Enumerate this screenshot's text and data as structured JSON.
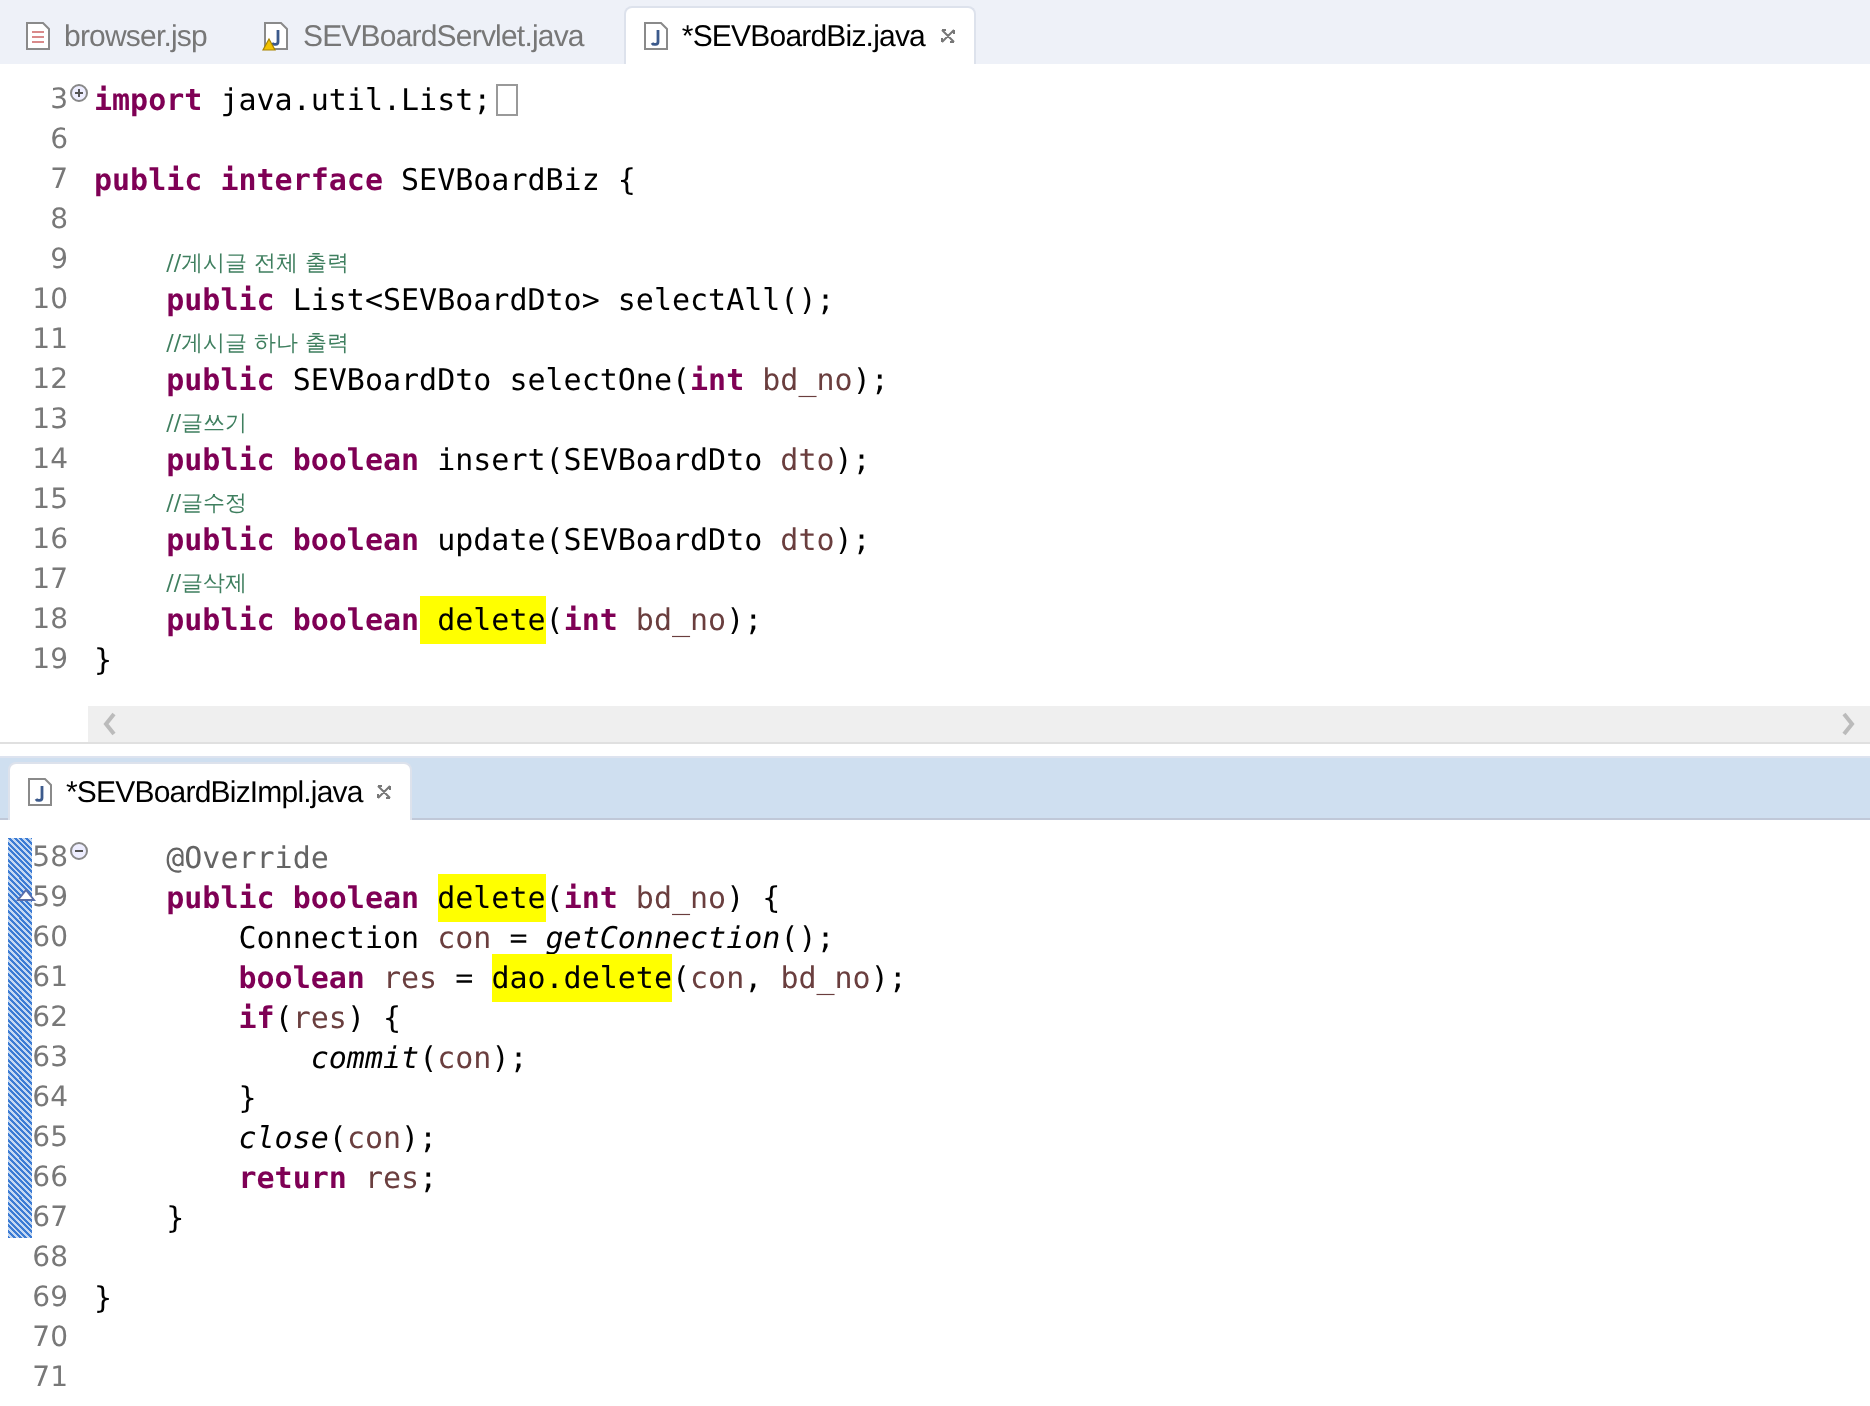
{
  "top_editor": {
    "tabs": [
      {
        "label": "browser.jsp",
        "kind": "jsp",
        "warning": false,
        "selected": false,
        "closable": false
      },
      {
        "label": "SEVBoardServlet.java",
        "kind": "java",
        "warning": true,
        "selected": false,
        "closable": false
      },
      {
        "label": "*SEVBoardBiz.java",
        "kind": "java",
        "warning": false,
        "selected": true,
        "closable": true
      }
    ],
    "lines": [
      {
        "number": "3",
        "folded": true,
        "changed": false,
        "override": false,
        "tokens": [
          {
            "kind": "kw",
            "t": "import",
            "highlighted": false
          },
          {
            "kind": "plain",
            "t": " java.util.List;",
            "highlighted": false
          }
        ]
      },
      {
        "number": "6",
        "changed": false,
        "override": false
      },
      {
        "number": "7",
        "changed": false,
        "override": false,
        "tokens": [
          {
            "kind": "kw",
            "t": "public interface",
            "highlighted": false
          },
          {
            "kind": "plain",
            "t": " SEVBoardBiz {",
            "highlighted": false
          }
        ]
      },
      {
        "number": "8",
        "changed": false,
        "override": false
      },
      {
        "number": "9",
        "changed": false,
        "override": false,
        "tokens": [
          {
            "kind": "comment",
            "t": "    //게시글 전체 출력",
            "highlighted": false
          }
        ]
      },
      {
        "number": "10",
        "changed": false,
        "override": false,
        "tokens": [
          {
            "kind": "kw",
            "t": "    public",
            "highlighted": false
          },
          {
            "kind": "plain",
            "t": " List<SEVBoardDto> selectAll();",
            "highlighted": false
          }
        ]
      },
      {
        "number": "11",
        "changed": false,
        "override": false,
        "tokens": [
          {
            "kind": "comment",
            "t": "    //게시글 하나 출력",
            "highlighted": false
          }
        ]
      },
      {
        "number": "12",
        "changed": false,
        "override": false,
        "tokens": [
          {
            "kind": "kw",
            "t": "    public",
            "highlighted": false
          },
          {
            "kind": "plain",
            "t": " SEVBoardDto selectOne(",
            "highlighted": false
          },
          {
            "kind": "kw",
            "t": "int",
            "highlighted": false
          },
          {
            "kind": "var",
            "t": " bd_no",
            "highlighted": false
          },
          {
            "kind": "plain",
            "t": ");",
            "highlighted": false
          }
        ]
      },
      {
        "number": "13",
        "changed": false,
        "override": false,
        "tokens": [
          {
            "kind": "comment",
            "t": "    //글쓰기",
            "highlighted": false
          }
        ]
      },
      {
        "number": "14",
        "changed": false,
        "override": false,
        "tokens": [
          {
            "kind": "kw",
            "t": "    public boolean",
            "highlighted": false
          },
          {
            "kind": "plain",
            "t": " insert(SEVBoardDto",
            "highlighted": false
          },
          {
            "kind": "var",
            "t": " dto",
            "highlighted": false
          },
          {
            "kind": "plain",
            "t": ");",
            "highlighted": false
          }
        ]
      },
      {
        "number": "15",
        "changed": false,
        "override": false,
        "tokens": [
          {
            "kind": "comment",
            "t": "    //글수정",
            "highlighted": false
          }
        ]
      },
      {
        "number": "16",
        "changed": false,
        "override": false,
        "tokens": [
          {
            "kind": "kw",
            "t": "    public boolean",
            "highlighted": false
          },
          {
            "kind": "plain",
            "t": " update(SEVBoardDto",
            "highlighted": false
          },
          {
            "kind": "var",
            "t": " dto",
            "highlighted": false
          },
          {
            "kind": "plain",
            "t": ");",
            "highlighted": false
          }
        ]
      },
      {
        "number": "17",
        "changed": false,
        "override": false,
        "tokens": [
          {
            "kind": "comment",
            "t": "    //글삭제",
            "highlighted": false
          }
        ]
      },
      {
        "number": "18",
        "changed": false,
        "override": false,
        "tokens": [
          {
            "kind": "kw",
            "t": "    public boolean",
            "highlighted": false
          },
          {
            "kind": "plain",
            "t": " delete",
            "highlighted": true
          },
          {
            "kind": "plain",
            "t": "(",
            "highlighted": false
          },
          {
            "kind": "kw",
            "t": "int",
            "highlighted": false
          },
          {
            "kind": "var",
            "t": " bd_no",
            "highlighted": false
          },
          {
            "kind": "plain",
            "t": ");",
            "highlighted": false
          }
        ]
      },
      {
        "number": "19",
        "changed": false,
        "override": false,
        "tokens": [
          {
            "kind": "plain",
            "t": "}",
            "highlighted": false
          }
        ]
      }
    ]
  },
  "bottom_editor": {
    "tabs": [
      {
        "label": "*SEVBoardBizImpl.java",
        "kind": "java",
        "warning": false,
        "selected": true,
        "closable": true
      }
    ],
    "lines": [
      {
        "number": "58",
        "folded": false,
        "changed": true,
        "override": false,
        "tokens": [
          {
            "kind": "annotation",
            "t": "    @Override",
            "highlighted": false
          }
        ]
      },
      {
        "number": "59",
        "changed": true,
        "override": true,
        "tokens": [
          {
            "kind": "kw",
            "t": "    public boolean ",
            "highlighted": false
          },
          {
            "kind": "plain",
            "t": "delete",
            "highlighted": true
          },
          {
            "kind": "plain",
            "t": "(",
            "highlighted": false
          },
          {
            "kind": "kw",
            "t": "int",
            "highlighted": false
          },
          {
            "kind": "var",
            "t": " bd_no",
            "highlighted": false
          },
          {
            "kind": "plain",
            "t": ") {",
            "highlighted": false
          }
        ]
      },
      {
        "number": "60",
        "changed": true,
        "override": false,
        "tokens": [
          {
            "kind": "plain",
            "t": "        Connection",
            "highlighted": false
          },
          {
            "kind": "var",
            "t": " con",
            "highlighted": false
          },
          {
            "kind": "plain",
            "t": " = ",
            "highlighted": false
          },
          {
            "kind": "static",
            "t": "getConnection",
            "highlighted": false
          },
          {
            "kind": "plain",
            "t": "();",
            "highlighted": false
          }
        ]
      },
      {
        "number": "61",
        "changed": true,
        "override": false,
        "tokens": [
          {
            "kind": "kw",
            "t": "        boolean",
            "highlighted": false
          },
          {
            "kind": "var",
            "t": " res",
            "highlighted": false
          },
          {
            "kind": "plain",
            "t": " = ",
            "highlighted": false
          },
          {
            "kind": "plain",
            "t": "dao.delete",
            "highlighted": true
          },
          {
            "kind": "plain",
            "t": "(",
            "highlighted": false
          },
          {
            "kind": "var",
            "t": "con",
            "highlighted": false
          },
          {
            "kind": "plain",
            "t": ", ",
            "highlighted": false
          },
          {
            "kind": "var",
            "t": "bd_no",
            "highlighted": false
          },
          {
            "kind": "plain",
            "t": ");",
            "highlighted": false
          }
        ]
      },
      {
        "number": "62",
        "changed": true,
        "override": false,
        "tokens": [
          {
            "kind": "kw",
            "t": "        if",
            "highlighted": false
          },
          {
            "kind": "plain",
            "t": "(",
            "highlighted": false
          },
          {
            "kind": "var",
            "t": "res",
            "highlighted": false
          },
          {
            "kind": "plain",
            "t": ") {",
            "highlighted": false
          }
        ]
      },
      {
        "number": "63",
        "changed": true,
        "override": false,
        "tokens": [
          {
            "kind": "static",
            "t": "            commit",
            "highlighted": false
          },
          {
            "kind": "plain",
            "t": "(",
            "highlighted": false
          },
          {
            "kind": "var",
            "t": "con",
            "highlighted": false
          },
          {
            "kind": "plain",
            "t": ");",
            "highlighted": false
          }
        ]
      },
      {
        "number": "64",
        "changed": true,
        "override": false,
        "tokens": [
          {
            "kind": "plain",
            "t": "        }",
            "highlighted": false
          }
        ]
      },
      {
        "number": "65",
        "changed": true,
        "override": false,
        "tokens": [
          {
            "kind": "static",
            "t": "        close",
            "highlighted": false
          },
          {
            "kind": "plain",
            "t": "(",
            "highlighted": false
          },
          {
            "kind": "var",
            "t": "con",
            "highlighted": false
          },
          {
            "kind": "plain",
            "t": ");",
            "highlighted": false
          }
        ]
      },
      {
        "number": "66",
        "changed": true,
        "override": false,
        "tokens": [
          {
            "kind": "kw",
            "t": "        return",
            "highlighted": false
          },
          {
            "kind": "var",
            "t": " res",
            "highlighted": false
          },
          {
            "kind": "plain",
            "t": ";",
            "highlighted": false
          }
        ]
      },
      {
        "number": "67",
        "changed": true,
        "override": false,
        "tokens": [
          {
            "kind": "plain",
            "t": "    }",
            "highlighted": false
          }
        ]
      },
      {
        "number": "68",
        "changed": false,
        "override": false
      },
      {
        "number": "69",
        "changed": false,
        "override": false,
        "tokens": [
          {
            "kind": "plain",
            "t": "}",
            "highlighted": false
          }
        ]
      },
      {
        "number": "70",
        "changed": false,
        "override": false
      },
      {
        "number": "71",
        "changed": false,
        "override": false
      }
    ]
  }
}
